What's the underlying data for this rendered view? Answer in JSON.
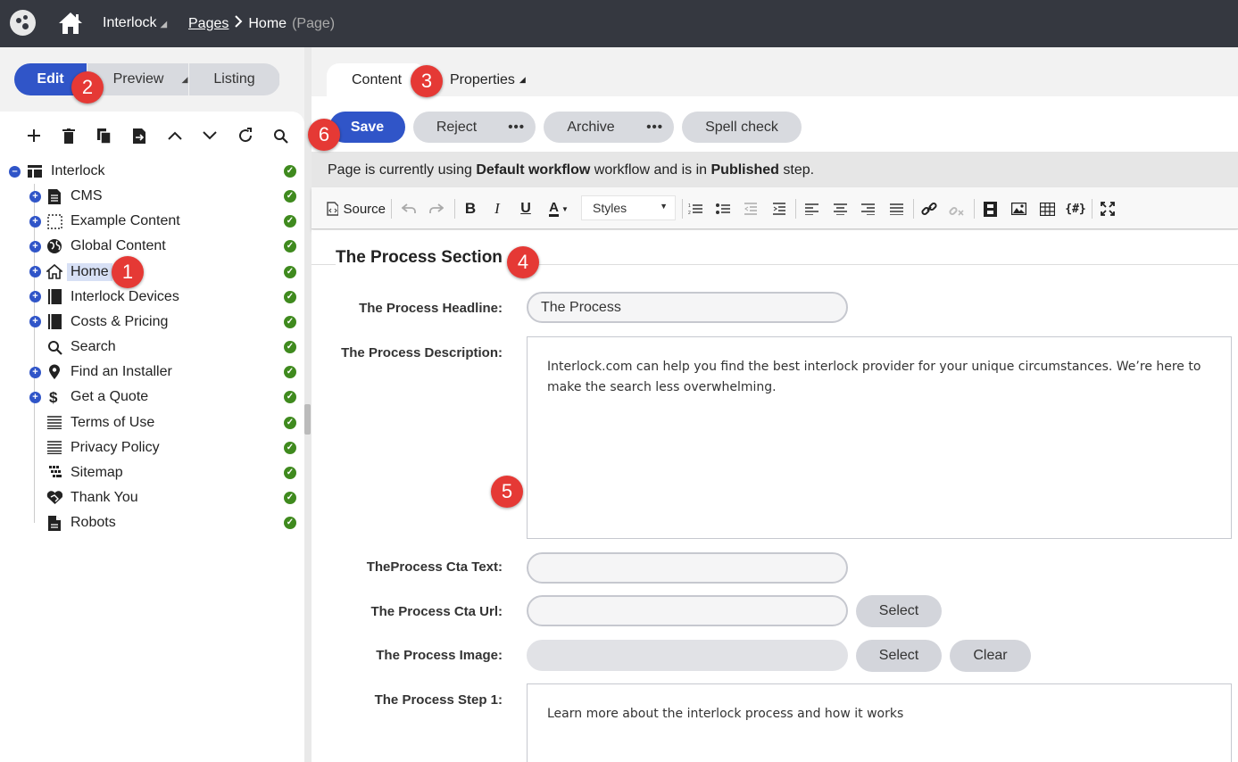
{
  "topbar": {
    "site_name": "Interlock",
    "breadcrumb_pages": "Pages",
    "breadcrumb_current": "Home",
    "breadcrumb_type": "(Page)"
  },
  "mode_tabs": {
    "edit": "Edit",
    "preview": "Preview",
    "listing": "Listing"
  },
  "tree": {
    "tools": [
      "add-icon",
      "delete-icon",
      "copy-icon",
      "move-icon",
      "chevron-up-icon",
      "chevron-down-icon",
      "refresh-icon",
      "search-icon"
    ],
    "root": "Interlock",
    "items": [
      {
        "label": "CMS",
        "icon": "document-icon",
        "expandable": true
      },
      {
        "label": "Example Content",
        "icon": "dashed-box-icon",
        "expandable": true
      },
      {
        "label": "Global Content",
        "icon": "globe-icon",
        "expandable": true
      },
      {
        "label": "Home",
        "icon": "home-icon",
        "expandable": true
      },
      {
        "label": "Interlock Devices",
        "icon": "book-icon",
        "expandable": true
      },
      {
        "label": "Costs & Pricing",
        "icon": "book-icon",
        "expandable": true
      },
      {
        "label": "Search",
        "icon": "search-icon",
        "expandable": false
      },
      {
        "label": "Find an Installer",
        "icon": "map-pin-icon",
        "expandable": true
      },
      {
        "label": "Get a Quote",
        "icon": "dollar-icon",
        "expandable": true
      },
      {
        "label": "Terms of Use",
        "icon": "lines-icon",
        "expandable": false
      },
      {
        "label": "Privacy Policy",
        "icon": "lines-icon",
        "expandable": false
      },
      {
        "label": "Sitemap",
        "icon": "sitemap-icon",
        "expandable": false
      },
      {
        "label": "Thank You",
        "icon": "handshake-icon",
        "expandable": false
      },
      {
        "label": "Robots",
        "icon": "file-icon",
        "expandable": false
      }
    ]
  },
  "content_tabs": {
    "content": "Content",
    "properties": "Properties"
  },
  "actions": {
    "save": "Save",
    "reject": "Reject",
    "archive": "Archive",
    "spell_check": "Spell check"
  },
  "workflow": {
    "prefix": "Page is currently using ",
    "workflow_name": "Default workflow",
    "middle": " workflow and is in ",
    "step": "Published",
    "suffix": " step."
  },
  "editor_toolbar": {
    "source": "Source",
    "styles": "Styles"
  },
  "form": {
    "section_title": "The Process Section",
    "headline_label": "The Process Headline:",
    "headline_value": "The Process",
    "description_label": "The Process Description:",
    "description_value": "Interlock.com can help you find the best interlock provider for your unique circumstances. We’re here to make the search less overwhelming.",
    "cta_text_label": "TheProcess Cta Text:",
    "cta_text_value": "",
    "cta_url_label": "The Process Cta Url:",
    "cta_url_value": "",
    "select_label": "Select",
    "image_label": "The Process Image:",
    "clear_label": "Clear",
    "step1_label": "The Process Step 1:",
    "step1_value": "Learn more about the interlock process and how it works"
  },
  "annotations": [
    "1",
    "2",
    "3",
    "4",
    "5",
    "6"
  ],
  "colors": {
    "accent": "#3055c8",
    "topbar": "#353840",
    "badge": "#e53935",
    "status_ok": "#3f8a1e"
  }
}
